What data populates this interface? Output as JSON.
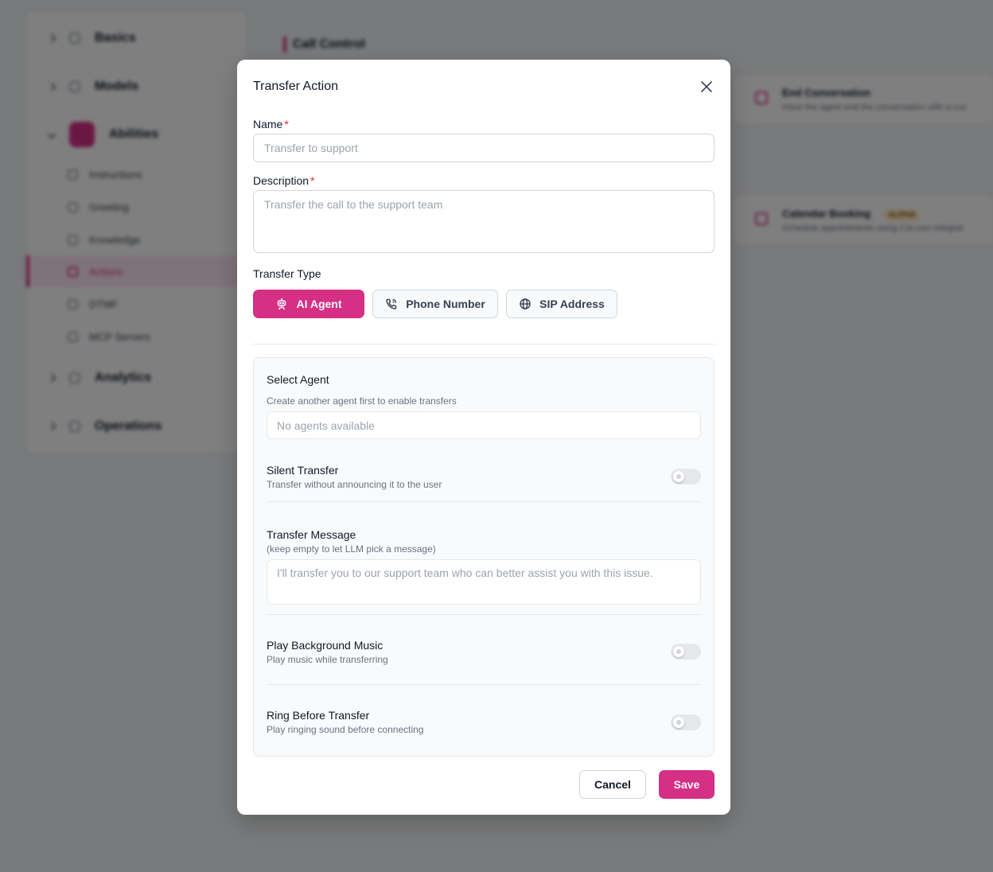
{
  "background": {
    "sidebar": {
      "sections": [
        {
          "label": "Basics"
        },
        {
          "label": "Models"
        },
        {
          "label": "Abilities"
        },
        {
          "label": "Analytics"
        },
        {
          "label": "Operations"
        }
      ],
      "ability_items": [
        "Instructions",
        "Greeting",
        "Knowledge",
        "Actions",
        "DTMF",
        "MCP Servers"
      ]
    },
    "main": {
      "section_title": "Call Control",
      "cards": [
        {
          "title": "End Conversation",
          "desc": "Have the agent end the conversation with a cus"
        },
        {
          "title": "Calendar Booking",
          "badge": "ALPHA",
          "desc": "Schedule appointments using Cal.com integrat"
        }
      ]
    }
  },
  "modal": {
    "title": "Transfer Action",
    "name": {
      "label": "Name",
      "required_mark": "*",
      "placeholder": "Transfer to support",
      "value": ""
    },
    "description": {
      "label": "Description",
      "required_mark": "*",
      "placeholder": "Transfer the call to the support team",
      "value": ""
    },
    "transfer_type": {
      "label": "Transfer Type",
      "selected": "AI Agent",
      "options": [
        {
          "label": "AI Agent",
          "icon": "bot-icon"
        },
        {
          "label": "Phone Number",
          "icon": "phone-icon"
        },
        {
          "label": "SIP Address",
          "icon": "globe-icon"
        }
      ]
    },
    "agent_panel": {
      "select_agent": {
        "label": "Select Agent",
        "hint": "Create another agent first to enable transfers",
        "placeholder": "No agents available"
      },
      "silent_transfer": {
        "label": "Silent Transfer",
        "desc": "Transfer without announcing it to the user",
        "enabled": false
      },
      "transfer_message": {
        "label": "Transfer Message",
        "hint": "(keep empty to let LLM pick a message)",
        "placeholder": "I'll transfer you to our support team who can better assist you with this issue.",
        "value": ""
      },
      "background_music": {
        "label": "Play Background Music",
        "desc": "Play music while transferring",
        "enabled": false
      },
      "ring_before": {
        "label": "Ring Before Transfer",
        "desc": "Play ringing sound before connecting",
        "enabled": false
      }
    },
    "footer": {
      "cancel_label": "Cancel",
      "save_label": "Save"
    }
  },
  "colors": {
    "accent": "#d62f86",
    "required": "#dc2626",
    "overlay": "rgba(0,0,0,0.5)"
  }
}
